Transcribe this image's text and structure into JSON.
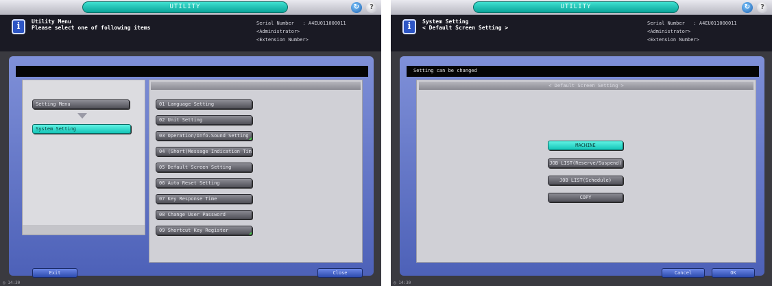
{
  "left": {
    "topbar_title": "UTILITY",
    "header": {
      "title": "Utility Menu\nPlease select one of following items",
      "serial": "Serial Number   : A4EU011000011",
      "role": "<Administrator>",
      "extension": "<Extension Number>"
    },
    "breadcrumb": [
      "Setting Menu",
      "System Setting"
    ],
    "items": [
      "01 Language Setting",
      "02 Unit Setting",
      "03 Operation/Info.Sound Setting",
      "04 (Short)Message Indication Time",
      "05 Default Screen Setting",
      "06 Auto Reset Setting",
      "07 Key Response Time",
      "08 Change User Password",
      "09 Shortcut Key Register"
    ],
    "exit_label": "Exit",
    "close_label": "Close",
    "clock": "14:30"
  },
  "right": {
    "topbar_title": "UTILITY",
    "header": {
      "title": "System Setting\n< Default Screen Setting >",
      "serial": "Serial Number   : A4EU011000011",
      "role": "<Administrator>",
      "extension": "<Extension Number>"
    },
    "message": "Setting can be changed",
    "dialog_title": "< Default Screen Setting >",
    "options": [
      "MACHINE",
      "JOB LIST(Reserve/Suspend)",
      "JOB LIST(Schedule)",
      "COPY"
    ],
    "selected_option": "MACHINE",
    "cancel_label": "Cancel",
    "ok_label": "OK",
    "clock": "14:30"
  },
  "colors": {
    "accent_cyan": "#14c5b8",
    "frame_blue": "#5a6dc2",
    "button_gray": "#6d6d75",
    "shortcut_corner_green": "#47d24a"
  }
}
